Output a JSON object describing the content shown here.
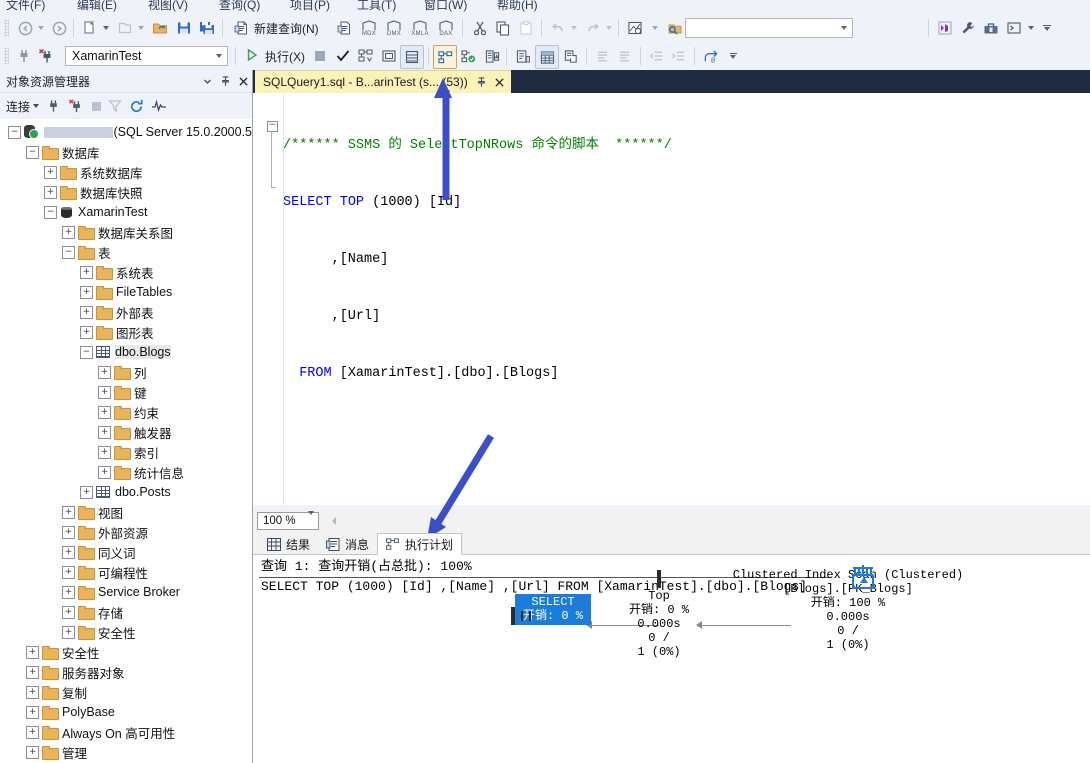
{
  "menu": {
    "items": [
      "文件(F)",
      "编辑(E)",
      "视图(V)",
      "查询(Q)",
      "项目(P)",
      "工具(T)",
      "窗口(W)",
      "帮助(H)"
    ]
  },
  "toolbar1": {
    "back_label": "back-navigate",
    "new_query_label": "新建查询(N)",
    "mdx_label": "MDX",
    "dmx_label": "DMX",
    "xmla_label": "XMLA",
    "dax_label": "DAX",
    "search_value": "",
    "search_placeholder": ""
  },
  "toolbar2": {
    "database_value": "XamarinTest",
    "execute_label": "执行(X)"
  },
  "object_explorer": {
    "title": "对象资源管理器",
    "connect_label": "连接",
    "server_suffix": "(SQL Server 15.0.2000.5",
    "tree": [
      {
        "depth": 0,
        "expander": "−",
        "icon": "server-icon",
        "label": "",
        "redacted": true,
        "suffix": "(SQL Server 15.0.2000.5"
      },
      {
        "depth": 1,
        "expander": "−",
        "icon": "folder-icon",
        "label": "数据库"
      },
      {
        "depth": 2,
        "expander": "+",
        "icon": "folder-icon",
        "label": "系统数据库"
      },
      {
        "depth": 2,
        "expander": "+",
        "icon": "folder-icon",
        "label": "数据库快照"
      },
      {
        "depth": 2,
        "expander": "−",
        "icon": "database-icon",
        "label": "XamarinTest"
      },
      {
        "depth": 3,
        "expander": "+",
        "icon": "folder-icon",
        "label": "数据库关系图"
      },
      {
        "depth": 3,
        "expander": "−",
        "icon": "folder-icon",
        "label": "表"
      },
      {
        "depth": 4,
        "expander": "+",
        "icon": "folder-icon",
        "label": "系统表"
      },
      {
        "depth": 4,
        "expander": "+",
        "icon": "folder-icon",
        "label": "FileTables"
      },
      {
        "depth": 4,
        "expander": "+",
        "icon": "folder-icon",
        "label": "外部表"
      },
      {
        "depth": 4,
        "expander": "+",
        "icon": "folder-icon",
        "label": "图形表"
      },
      {
        "depth": 4,
        "expander": "−",
        "icon": "table-icon",
        "label": "dbo.Blogs",
        "selected": true
      },
      {
        "depth": 5,
        "expander": "+",
        "icon": "folder-icon",
        "label": "列"
      },
      {
        "depth": 5,
        "expander": "+",
        "icon": "folder-icon",
        "label": "键"
      },
      {
        "depth": 5,
        "expander": "+",
        "icon": "folder-icon",
        "label": "约束"
      },
      {
        "depth": 5,
        "expander": "+",
        "icon": "folder-icon",
        "label": "触发器"
      },
      {
        "depth": 5,
        "expander": "+",
        "icon": "folder-icon",
        "label": "索引"
      },
      {
        "depth": 5,
        "expander": "+",
        "icon": "folder-icon",
        "label": "统计信息"
      },
      {
        "depth": 4,
        "expander": "+",
        "icon": "table-icon",
        "label": "dbo.Posts"
      },
      {
        "depth": 3,
        "expander": "+",
        "icon": "folder-icon",
        "label": "视图"
      },
      {
        "depth": 3,
        "expander": "+",
        "icon": "folder-icon",
        "label": "外部资源"
      },
      {
        "depth": 3,
        "expander": "+",
        "icon": "folder-icon",
        "label": "同义词"
      },
      {
        "depth": 3,
        "expander": "+",
        "icon": "folder-icon",
        "label": "可编程性"
      },
      {
        "depth": 3,
        "expander": "+",
        "icon": "folder-icon",
        "label": "Service Broker"
      },
      {
        "depth": 3,
        "expander": "+",
        "icon": "folder-icon",
        "label": "存储"
      },
      {
        "depth": 3,
        "expander": "+",
        "icon": "folder-icon",
        "label": "安全性"
      },
      {
        "depth": 1,
        "expander": "+",
        "icon": "folder-icon",
        "label": "安全性"
      },
      {
        "depth": 1,
        "expander": "+",
        "icon": "folder-icon",
        "label": "服务器对象"
      },
      {
        "depth": 1,
        "expander": "+",
        "icon": "folder-icon",
        "label": "复制"
      },
      {
        "depth": 1,
        "expander": "+",
        "icon": "folder-icon",
        "label": "PolyBase"
      },
      {
        "depth": 1,
        "expander": "+",
        "icon": "folder-icon",
        "label": "Always On 高可用性"
      },
      {
        "depth": 1,
        "expander": "+",
        "icon": "folder-icon",
        "label": "管理"
      }
    ]
  },
  "editor": {
    "tab_title": "SQLQuery1.sql - B...arinTest (s... (53))",
    "code_lines": [
      {
        "type": "comment",
        "text": "/****** SSMS 的 SelectTopNRows 命令的脚本  ******/"
      },
      {
        "type": "sql1",
        "text": "SELECT TOP (1000) [Id]"
      },
      {
        "type": "plain",
        "text": "      ,[Name]"
      },
      {
        "type": "plain",
        "text": "      ,[Url]"
      },
      {
        "type": "sql2",
        "text": "  FROM [XamarinTest].[dbo].[Blogs]"
      }
    ]
  },
  "results": {
    "zoom_value": "100 %",
    "tabs": [
      {
        "label": "结果",
        "icon": "grid-icon",
        "active": false
      },
      {
        "label": "消息",
        "icon": "message-icon",
        "active": false
      },
      {
        "label": "执行计划",
        "icon": "plan-icon",
        "active": true
      }
    ]
  },
  "plan": {
    "header_line1": "查询 1: 查询开销(占总批): 100%",
    "header_line2": "SELECT TOP (1000) [Id] ,[Name] ,[Url] FROM [XamarinTest].[dbo].[Blogs]",
    "nodes": [
      {
        "id": "select",
        "icon": "select-op-icon",
        "title": "SELECT",
        "cost": "开销: 0 %",
        "highlighted": true,
        "lines": []
      },
      {
        "id": "top",
        "icon": "top-op-icon",
        "title": "Top",
        "cost": "开销: 0 %",
        "highlighted": false,
        "lines": [
          "0.000s",
          "0 /",
          "1 (0%)"
        ]
      },
      {
        "id": "clustered-index-scan",
        "icon": "clustered-index-scan-icon",
        "title": "Clustered Index Scan (Clustered)",
        "subtitle": "[Blogs].[PK_Blogs]",
        "cost": "开销: 100 %",
        "highlighted": false,
        "lines": [
          "0.000s",
          "0 /",
          "1 (0%)"
        ]
      }
    ]
  },
  "colors": {
    "accent_blue": "#1a7ddb",
    "tab_yellow": "#fbf2b8",
    "annotation_arrow": "#3b50c8",
    "comment_green": "#008000",
    "keyword_blue": "#0000ff",
    "folder_gold": "#e8b55a"
  }
}
